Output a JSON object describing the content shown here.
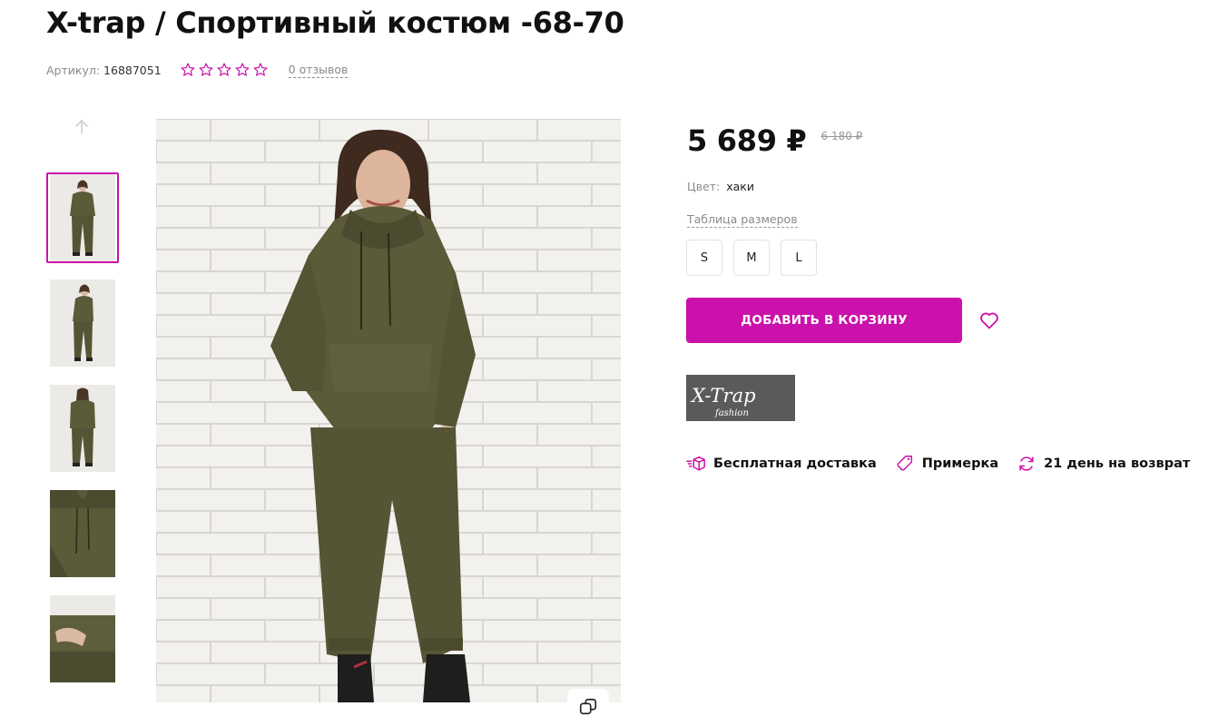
{
  "product": {
    "title": "X-trap / Спортивный костюм -68-70",
    "sku_label": "Артикул:",
    "sku_value": "16887051",
    "rating_stars": 5,
    "rating_filled": 0,
    "reviews_link": "0 отзывов"
  },
  "gallery": {
    "up_icon": "arrow-up-icon",
    "thumbnails": [
      {
        "alt": "front-full",
        "active": true
      },
      {
        "alt": "side-full",
        "active": false
      },
      {
        "alt": "back-full",
        "active": false
      },
      {
        "alt": "hood-detail",
        "active": false
      },
      {
        "alt": "pocket-detail",
        "active": false
      }
    ],
    "zoom_icon": "copy-icon"
  },
  "pricing": {
    "price": "5 689 ₽",
    "old_price": "6 180 ₽"
  },
  "options": {
    "color_label": "Цвет:",
    "color_value": "хаки",
    "size_table_link": "Таблица размеров",
    "sizes": [
      "S",
      "M",
      "L"
    ]
  },
  "actions": {
    "add_to_cart": "ДОБАВИТЬ В КОРЗИНУ",
    "favorite_icon": "heart-icon"
  },
  "brand": {
    "logo_text": "X-Trap",
    "logo_subtext": "fashion"
  },
  "perks": [
    {
      "icon": "delivery-box-icon",
      "label": "Бесплатная доставка"
    },
    {
      "icon": "hanger-tag-icon",
      "label": "Примерка"
    },
    {
      "icon": "refresh-icon",
      "label": "21 день на возврат"
    }
  ],
  "colors": {
    "accent": "#cb11ab",
    "text_primary": "#111111",
    "text_secondary": "#8a8a8a",
    "garment_khaki": "#5b5a39",
    "logo_bg": "#5a5a5a"
  }
}
